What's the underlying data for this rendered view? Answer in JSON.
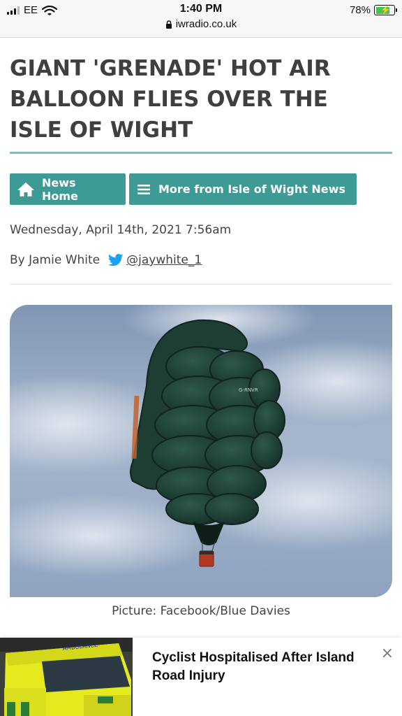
{
  "status_bar": {
    "carrier": "EE",
    "time": "1:40 PM",
    "url": "iwradio.co.uk",
    "battery": "78%",
    "battery_level": 0.78,
    "icons": [
      "signal-icon",
      "wifi-icon",
      "lock-icon",
      "battery-icon"
    ]
  },
  "article": {
    "headline": "GIANT 'GRENADE' HOT AIR BALLOON FLIES OVER THE ISLE OF WIGHT",
    "buttons": {
      "home_label": "News Home",
      "home_icon": "home-icon",
      "more_label": "More from Isle of Wight News",
      "more_icon": "menu-icon"
    },
    "date": "Wednesday, April 14th, 2021 7:56am",
    "author": "By Jamie White",
    "twitter_handle": "@jaywhite_1",
    "twitter_icon": "twitter-icon",
    "photo_registration": "G-RNVR",
    "caption": "Picture: Facebook/Blue Davies"
  },
  "ad": {
    "title": "Cyclist Hospitalised After Island Road Injury",
    "image_text": "AMBULANCE",
    "close_icon": "close-icon"
  },
  "colors": {
    "accent_teal": "#3e9a94",
    "rule_teal": "#6fc6c0",
    "twitter_blue": "#1da1f2",
    "headline_gray": "#3f3f3f"
  }
}
